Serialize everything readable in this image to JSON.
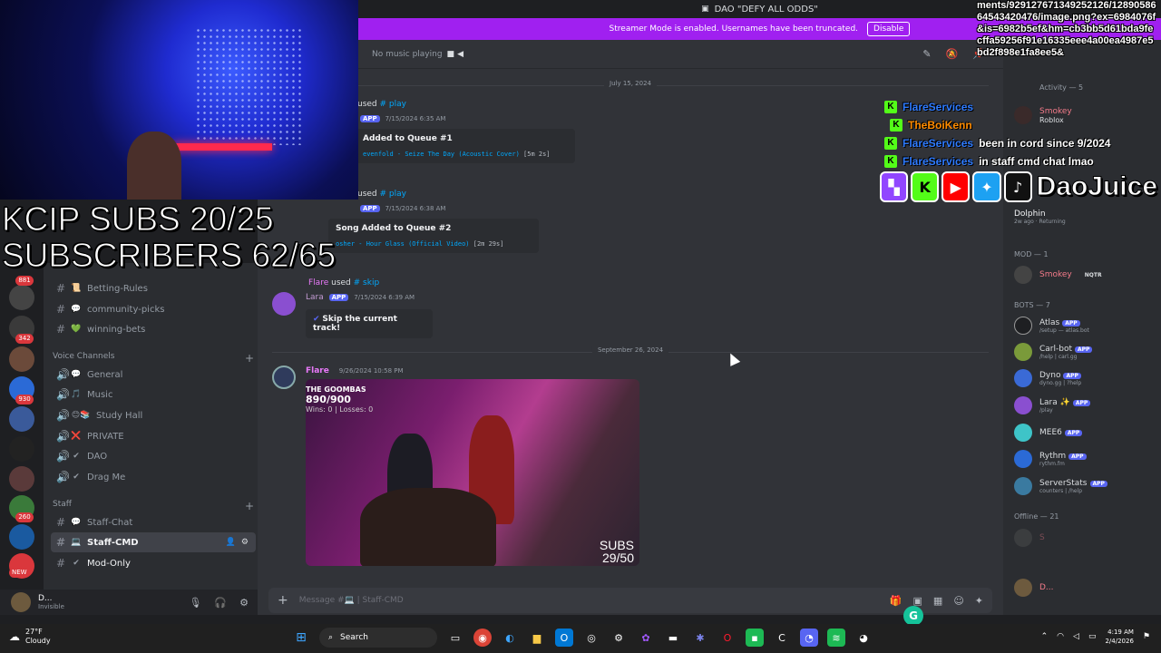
{
  "window": {
    "title": "DAO \"DEFY ALL ODDS\"",
    "streamer_banner": "Streamer Mode is enabled. Usernames have been truncated.",
    "streamer_button": "Disable"
  },
  "overlay": {
    "kcip_subs": "KCIP SUBS 20/25",
    "subscribers": "SUBSCRIBERS 62/65",
    "url_text": "ments/929127671349252126/1289058664543420476/image.png?ex=6984076f&is=6982b5ef&hm=cb3bb5d61bda9fecffa59256f91e16335eee4a00ea4987e5bd2f898e1fa8ee5&",
    "stream_chat": [
      {
        "user": "FlareServices",
        "user_color": "#2e7bff",
        "message": ""
      },
      {
        "user": "TheBoiKenn",
        "user_color": "#ff8c00",
        "message": ""
      },
      {
        "user": "FlareServices",
        "user_color": "#2e7bff",
        "message": "been in cord since 9/2024"
      },
      {
        "user": "FlareServices",
        "user_color": "#2e7bff",
        "message": "in staff cmd chat lmao"
      }
    ],
    "social_handle": "DaoJuice",
    "social_icons": [
      "twitch-icon",
      "kick-icon",
      "youtube-icon",
      "twitter-icon",
      "tiktok-icon"
    ]
  },
  "rail": {
    "badges": [
      "881",
      "342",
      "930",
      "260",
      "NEW"
    ]
  },
  "sidebar": {
    "channels_top": [
      {
        "label": "Betting-Rules",
        "emoji": "📜"
      },
      {
        "label": "community-picks",
        "emoji": "💬"
      },
      {
        "label": "winning-bets",
        "emoji": "💚"
      }
    ],
    "voice_category": "Voice Channels",
    "voice_channels": [
      {
        "label": "General",
        "emoji": "💬"
      },
      {
        "label": "Music",
        "emoji": "🎵"
      },
      {
        "label": "Study Hall",
        "emoji": "😊📚"
      },
      {
        "label": "PRIVATE",
        "emoji": "❌"
      },
      {
        "label": "DAO",
        "emoji": "✔"
      },
      {
        "label": "Drag Me",
        "emoji": "✔"
      }
    ],
    "staff_category": "Staff",
    "staff_channels": [
      {
        "label": "Staff-Chat",
        "emoji": "💬"
      },
      {
        "label": "Staff-CMD",
        "emoji": "💻"
      },
      {
        "label": "Mod-Only",
        "emoji": "✔"
      }
    ]
  },
  "userpanel": {
    "name": "D...",
    "status": "Invisible"
  },
  "chat": {
    "header_status": "No music playing",
    "date1": "July 15, 2024",
    "messages": [
      {
        "used": "used",
        "command": "# play",
        "timestamp": "7/15/2024 6:35 AM",
        "embed_title": "Added to Queue #1",
        "embed_song": "evenfold - Seize The Day (Acoustic Cover)",
        "embed_len": "[5m 2s]"
      },
      {
        "used": "used",
        "command": "# play",
        "timestamp": "7/15/2024 6:38 AM",
        "embed_title": "Song Added to Queue #2",
        "embed_song": "osher - Hour Glass (Official Video)",
        "embed_len": "[2m 29s]"
      }
    ],
    "skip_msg": {
      "user_used": "Flare",
      "used": "used",
      "command": "# skip",
      "bot": "Lara",
      "app": "APP",
      "timestamp": "7/15/2024 6:39 AM",
      "text": "Skip the current track!"
    },
    "date2": "September 26, 2024",
    "image_msg": {
      "user": "Flare",
      "timestamp": "9/26/2024 10:58 PM",
      "overlay_goombas": "THE GOOMBAS",
      "overlay_count": "890/900",
      "overlay_record": "Wins: 0 | Losses: 0",
      "overlay_subs": "SUBS",
      "overlay_subs_count": "29/50"
    },
    "composer_placeholder": "Message #💻 | Staff-CMD"
  },
  "members": {
    "activity_label": "Activity — 5",
    "activity": [
      {
        "name": "Smokey",
        "sub": "Roblox"
      },
      {
        "name": "Dolphin",
        "sub": "2w ago · Returning"
      }
    ],
    "mod_label": "MOD — 1",
    "mods": [
      {
        "name": "Smokey",
        "tag": "NQTR",
        "color": "#f47b8a"
      }
    ],
    "bots_label": "BOTS — 7",
    "bots": [
      {
        "name": "Atlas",
        "sub": "/setup — atlas.bot",
        "color": "#949ba4",
        "avatar": "#1e1f22"
      },
      {
        "name": "Carl-bot",
        "sub": "/help | carl.gg",
        "color": "#949ba4",
        "avatar": "#7a9a3a"
      },
      {
        "name": "Dyno",
        "sub": "dyno.gg | ?help",
        "color": "#949ba4",
        "avatar": "#3a6ad6"
      },
      {
        "name": "Lara ✨",
        "sub": "/play",
        "color": "#949ba4",
        "avatar": "#8a4fd0"
      },
      {
        "name": "MEE6",
        "sub": "",
        "color": "#949ba4",
        "avatar": "#3ec4c8"
      },
      {
        "name": "Rythm",
        "sub": "rythm.fm",
        "color": "#949ba4",
        "avatar": "#2b6ad6"
      },
      {
        "name": "ServerStats",
        "sub": "counters | /help",
        "color": "#949ba4",
        "avatar": "#3a7aa0"
      }
    ],
    "bot_tag": "APP",
    "offline_label": "Offline — 21",
    "offline": [
      {
        "name": "S"
      },
      {
        "name": "D..."
      }
    ]
  },
  "taskbar": {
    "temp": "27°F",
    "weather": "Cloudy",
    "search": "Search",
    "time": "4:19 AM",
    "date": "2/4/2026"
  },
  "colors": {
    "accent": "#5865f2",
    "streamer": "#a020f0",
    "kick": "#53fc18"
  }
}
